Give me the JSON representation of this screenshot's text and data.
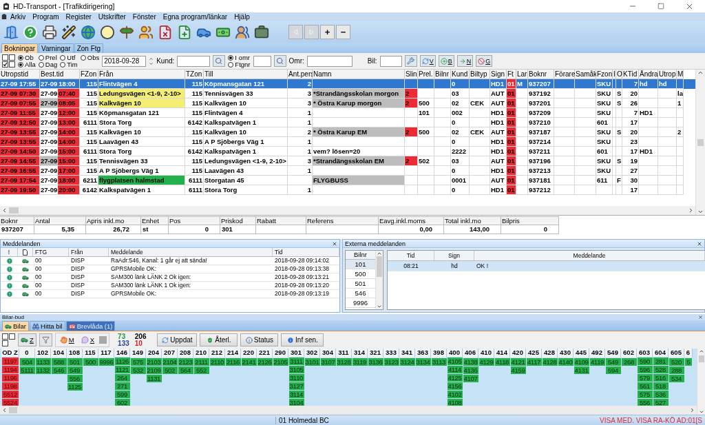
{
  "window": {
    "title": "HD-Transport - [Trafikdirigering]"
  },
  "menu": [
    "Arkiv",
    "Program",
    "Register",
    "Utskrifter",
    "Fönster",
    "Egna program/länkar",
    "Hjälp"
  ],
  "nav_buttons": [
    {
      "kind": "back",
      "disabled": true
    },
    {
      "kind": "forward",
      "disabled": true
    },
    {
      "kind": "text",
      "label": "+",
      "disabled": false
    },
    {
      "kind": "text",
      "label": "−",
      "disabled": false
    }
  ],
  "tabs": [
    {
      "label": "Bokningar",
      "selected": true
    },
    {
      "label": "Varningar",
      "selected": false
    },
    {
      "label": "Zon Ftg",
      "selected": false
    }
  ],
  "filter": {
    "checkboxes": [
      {
        "checked": false
      },
      {
        "checked": false
      },
      {
        "checked": true
      },
      {
        "checked": false
      }
    ],
    "status_radios": [
      {
        "label": "Ob",
        "selected": true
      },
      {
        "label": "Prel",
        "selected": false
      },
      {
        "label": "Utf",
        "selected": false
      },
      {
        "label": "Obs",
        "selected": false
      }
    ],
    "period_radios": [
      {
        "label": "Alla",
        "selected": true
      },
      {
        "label": "Dag",
        "selected": false
      },
      {
        "label": "Tim",
        "selected": false
      }
    ],
    "date": "2018-09-28",
    "kund_label": "Kund:",
    "area_radios": [
      {
        "label": "I omr",
        "selected": true
      },
      {
        "label": "Ftgnr",
        "selected": false
      }
    ],
    "omr_label": "Omr:",
    "bil_label": "Bil:",
    "action_buttons": [
      "V",
      "B",
      "N",
      "G"
    ]
  },
  "bookings": {
    "columns": [
      {
        "label": "Utropstid",
        "kind": "text"
      },
      {
        "label": "Best.tid",
        "kind": "split"
      },
      {
        "label": "FZon",
        "kind": "number"
      },
      {
        "label": "Från",
        "kind": "text"
      },
      {
        "label": "TZon",
        "kind": "number"
      },
      {
        "label": "Till",
        "kind": "text"
      },
      {
        "label": "Ant.pers",
        "kind": "number"
      },
      {
        "label": "Namn",
        "kind": "text"
      },
      {
        "label": "Slin",
        "kind": "text"
      },
      {
        "label": "Prel.",
        "kind": "text"
      },
      {
        "label": "Bilnr",
        "kind": "text"
      },
      {
        "label": "Kund",
        "kind": "text"
      },
      {
        "label": "Biltyp",
        "kind": "text"
      },
      {
        "label": "Sign",
        "kind": "text"
      },
      {
        "label": "Ft",
        "kind": "flag"
      },
      {
        "label": "Lar",
        "kind": "text"
      },
      {
        "label": "Boknr",
        "kind": "text"
      },
      {
        "label": "Förare",
        "kind": "text"
      },
      {
        "label": "Samåk",
        "kind": "text"
      },
      {
        "label": "Fzon",
        "kind": "text"
      },
      {
        "label": "I",
        "kind": "text"
      },
      {
        "label": "O",
        "kind": "text"
      },
      {
        "label": "KTid",
        "kind": "number"
      },
      {
        "label": "Ändra",
        "kind": "text"
      },
      {
        "label": "Utrop",
        "kind": "text"
      },
      {
        "label": "M",
        "kind": "text"
      }
    ],
    "rows": [
      {
        "selected": true,
        "alarm": false,
        "best_gray": false,
        "best_time": "18:00",
        "namn_gray": false,
        "slin_alarm": false,
        "cells": [
          "27-09 17:55",
          "27-09",
          "115",
          "Flintvägen 4",
          "115",
          "Köpmansgatan 121",
          "2",
          null,
          null,
          null,
          null,
          "0",
          null,
          "HD1",
          "01",
          "M",
          "937207",
          null,
          null,
          "SKU",
          null,
          null,
          "7",
          "hd",
          "hd",
          null
        ]
      },
      {
        "selected": false,
        "alarm": true,
        "best_gray": false,
        "best_time": "07:40",
        "color": "#f4ef72",
        "namn_gray": true,
        "slin_alarm": true,
        "cells": [
          "27-09 07:30",
          "27-09",
          "115",
          "Ledungsvägen <1-9, 2-10>",
          "115",
          "Tennisvägen 33",
          "3",
          "*Strandängsskolan morgon",
          "2",
          null,
          null,
          "03",
          null,
          "AUT",
          "01",
          null,
          "937192",
          null,
          null,
          "SKU",
          null,
          "S",
          "20",
          null,
          null,
          "la"
        ]
      },
      {
        "selected": false,
        "alarm": true,
        "best_gray": true,
        "best_time": "08:05",
        "color": "#f4ef72",
        "namn_gray": true,
        "slin_alarm": true,
        "cells": [
          "27-09 07:55",
          "27-09",
          "115",
          "Kalkvägen 10",
          "115",
          "Kalkvägen 10",
          "3",
          "* Östra Karup morgon",
          "2",
          "500",
          null,
          "02",
          "CEK",
          "AUT",
          "01",
          null,
          "937201",
          null,
          null,
          "SKU",
          null,
          "S",
          "26",
          null,
          null,
          "1"
        ]
      },
      {
        "selected": false,
        "alarm": true,
        "best_gray": false,
        "best_time": "12:00",
        "namn_gray": false,
        "slin_alarm": false,
        "cells": [
          "27-09 11:55",
          "27-09",
          "115",
          "Köpmansgatan 121",
          "115",
          "Flintvägen 4",
          "1",
          null,
          null,
          "101",
          null,
          "002",
          null,
          "HD1",
          "01",
          null,
          "937209",
          null,
          null,
          "SKU",
          null,
          null,
          "7",
          "HD1",
          null,
          null
        ]
      },
      {
        "selected": false,
        "alarm": true,
        "best_gray": false,
        "best_time": "13:00",
        "namn_gray": false,
        "slin_alarm": false,
        "cells": [
          "27-09 12:50",
          "27-09",
          "6111",
          "Stora Torg",
          "6142",
          "Kalkspatvägen 1",
          "1",
          null,
          null,
          null,
          null,
          "0",
          null,
          "HD1",
          "01",
          null,
          "937210",
          null,
          null,
          "601",
          null,
          null,
          "17",
          null,
          null,
          null
        ]
      },
      {
        "selected": false,
        "alarm": true,
        "best_gray": false,
        "best_time": "14:00",
        "namn_gray": true,
        "slin_alarm": true,
        "cells": [
          "27-09 13:55",
          "27-09",
          "115",
          "Kalkvägen 10",
          "115",
          "Kalkvägen 10",
          "2",
          "* Östra Karup EM",
          "2",
          "500",
          null,
          "02",
          "CEK",
          "AUT",
          "01",
          null,
          "937187",
          null,
          null,
          "SKU",
          null,
          "S",
          "20",
          null,
          null,
          "2"
        ]
      },
      {
        "selected": false,
        "alarm": true,
        "best_gray": false,
        "best_time": "14:00",
        "namn_gray": false,
        "slin_alarm": false,
        "cells": [
          "27-09 13:55",
          "27-09",
          "115",
          "Laavägen 43",
          "115",
          "A P Sjöbergs Väg 1",
          "1",
          null,
          null,
          null,
          null,
          "0",
          null,
          "HD1",
          "01",
          null,
          "937214",
          null,
          null,
          "SKU",
          null,
          null,
          "23",
          null,
          null,
          null
        ]
      },
      {
        "selected": false,
        "alarm": true,
        "best_gray": false,
        "best_time": "15:00",
        "namn_gray": false,
        "slin_alarm": false,
        "cells": [
          "27-09 14:50",
          "27-09",
          "6111",
          "Stora Torg",
          "6142",
          "Kalkspatvägen 1",
          "1",
          "vem? lösen=20",
          null,
          null,
          null,
          "2222",
          null,
          "HD1",
          "01",
          null,
          "937211",
          null,
          null,
          "601",
          null,
          null,
          "17",
          "HD1",
          null,
          null
        ]
      },
      {
        "selected": false,
        "alarm": true,
        "best_gray": true,
        "best_time": "15:00",
        "namn_gray": true,
        "slin_alarm": true,
        "cells": [
          "27-09 14:55",
          "27-09",
          "115",
          "Tennisvägen 33",
          "115",
          "Ledungsvägen <1-9, 2-10>",
          "3",
          "*Strandängsskolan EM",
          "2",
          "502",
          null,
          "03",
          null,
          "AUT",
          "01",
          null,
          "937196",
          null,
          null,
          "SKU",
          null,
          "S",
          "19",
          null,
          null,
          null
        ]
      },
      {
        "selected": false,
        "alarm": true,
        "best_gray": false,
        "best_time": "17:00",
        "namn_gray": false,
        "slin_alarm": false,
        "cells": [
          "27-09 16:55",
          "27-09",
          "115",
          "A P Sjöbergs Väg 1",
          "115",
          "Laavägen 43",
          "1",
          null,
          null,
          null,
          null,
          "0",
          null,
          "HD1",
          "01",
          null,
          "937213",
          null,
          null,
          "SKU",
          null,
          null,
          "27",
          null,
          null,
          null
        ]
      },
      {
        "selected": false,
        "alarm": true,
        "best_gray": false,
        "best_time": "18:00",
        "color": "#22b14c",
        "namn_gray": true,
        "slin_alarm": false,
        "cells": [
          "27-09 17:54",
          "27-09",
          "6211",
          "flygplatsen halmstad",
          "6111",
          "Storgatan 45",
          null,
          "FLYGBUSS",
          null,
          null,
          null,
          "0001",
          null,
          "AUT",
          "01",
          null,
          "937181",
          null,
          null,
          "611",
          null,
          "F",
          "30",
          null,
          null,
          null
        ]
      },
      {
        "selected": false,
        "alarm": true,
        "best_gray": false,
        "best_time": "20:00",
        "namn_gray": false,
        "slin_alarm": false,
        "cells": [
          "27-09 19:50",
          "27-09",
          "6142",
          "Kalkspatvägen 1",
          "6111",
          "Stora Torg",
          "1",
          null,
          null,
          null,
          null,
          "0",
          null,
          "HD1",
          "01",
          null,
          "937212",
          null,
          null,
          null,
          null,
          null,
          "17",
          null,
          null,
          null
        ]
      }
    ]
  },
  "price": {
    "columns": [
      {
        "label": "Boknr",
        "value": "937207"
      },
      {
        "label": "Antal",
        "value": "5,35"
      },
      {
        "label": "Apris inkl.mo",
        "value": "26,72"
      },
      {
        "label": "Enhet",
        "value": "st"
      },
      {
        "label": "Pos",
        "value": "0"
      },
      {
        "label": "Priskod",
        "value": "301"
      },
      {
        "label": "Rabatt"
      },
      {
        "label": "Referens"
      },
      {
        "label": "Eavg.inkl.moms",
        "value": "0,00"
      },
      {
        "label": "Total inkl.mo",
        "value": "143,00"
      },
      {
        "label": "Bilpris",
        "value": "0"
      }
    ]
  },
  "messages": {
    "title": "Meddelanden",
    "columns": [
      "!",
      "FTG",
      "Från",
      "Meddelande",
      "Tid"
    ],
    "rows": [
      {
        "ftg": "00",
        "from": "DISP",
        "text": "RaAdr:546, Kanal: 1 går ej att sända!",
        "time": "2018-09-28 09:14:02"
      },
      {
        "ftg": "00",
        "from": "DISP",
        "text": "GPRSMobile OK:",
        "time": "2018-09-28 09:13:38"
      },
      {
        "ftg": "00",
        "from": "DISP",
        "text": "SAM300 länk LÄNK 2 Ok igen:",
        "time": "2018-09-28 09:13:21"
      },
      {
        "ftg": "00",
        "from": "DISP",
        "text": "SAM300 länk LÄNK 1 Ok igen:",
        "time": "2018-09-28 09:13:20"
      },
      {
        "ftg": "00",
        "from": "DISP",
        "text": "GPRSMobile OK:",
        "time": "2018-09-28 09:13:19"
      }
    ]
  },
  "external": {
    "title": "Externa meddelanden",
    "car_header": "Bilnr",
    "cars": [
      {
        "label": "101",
        "selected": true
      },
      {
        "label": "500",
        "selected": false
      },
      {
        "label": "501",
        "selected": false
      },
      {
        "label": "546",
        "selected": false
      },
      {
        "label": "9996",
        "selected": false
      }
    ],
    "columns": [
      "Tid",
      "Sign",
      "Meddelande"
    ],
    "rows": [
      {
        "time": "08:21",
        "sign": "hd",
        "text": "OK !",
        "selected": true
      }
    ]
  },
  "fleet": {
    "title": "Bilar-bud",
    "tabs": [
      {
        "label": "Bilar",
        "selected": true,
        "highlighted": false
      },
      {
        "label": "Hitta bil",
        "selected": false,
        "highlighted": false
      },
      {
        "label": "Brevlåda (1)",
        "selected": false,
        "highlighted": true
      }
    ],
    "checkboxes": [
      {
        "checked": false
      },
      {
        "checked": false
      },
      {
        "checked": false
      }
    ],
    "mode_labels": [
      "Z",
      "M",
      "X"
    ],
    "counters": [
      {
        "value": "73",
        "color": "#1f9a3a"
      },
      {
        "value": "206",
        "color": "#000000"
      },
      {
        "value": "133",
        "color": "#2b3f9e"
      },
      {
        "value": "10",
        "color": "#e0202a"
      }
    ],
    "buttons": [
      "Uppdat",
      "Återl.",
      "Status",
      "Inf sen."
    ],
    "od": {
      "label": "OD Z",
      "cars": [
        "1197",
        "1194",
        "1196",
        "1198",
        "5512",
        "5524"
      ]
    },
    "zones": [
      {
        "zone": "0",
        "cars": [
          "504",
          "5111"
        ]
      },
      {
        "zone": "102",
        "cars": [
          "1133",
          "1132"
        ]
      },
      {
        "zone": "104",
        "cars": [
          "588",
          "546"
        ]
      },
      {
        "zone": "108",
        "cars": [
          "501",
          "549",
          "556",
          "1125"
        ]
      },
      {
        "zone": "115",
        "cars": [
          "500"
        ]
      },
      {
        "zone": "117",
        "cars": [
          "9996"
        ]
      },
      {
        "zone": "146",
        "cars": [
          "1126",
          "1121",
          "264",
          "271",
          "599",
          "602"
        ]
      },
      {
        "zone": "149",
        "cars": [
          "575",
          "532"
        ]
      },
      {
        "zone": "204",
        "cars": [
          "2103",
          "2109",
          "1131"
        ]
      },
      {
        "zone": "207",
        "cars": [
          "2104",
          "502"
        ]
      },
      {
        "zone": "208",
        "cars": [
          "2123",
          "564"
        ]
      },
      {
        "zone": "210",
        "cars": [
          "2111",
          "552"
        ]
      },
      {
        "zone": "212",
        "cars": [
          "2110"
        ]
      },
      {
        "zone": "214",
        "cars": [
          "2116"
        ]
      },
      {
        "zone": "220",
        "cars": [
          "2141"
        ]
      },
      {
        "zone": "221",
        "cars": [
          "2126"
        ]
      },
      {
        "zone": "290",
        "cars": [
          "2105"
        ]
      },
      {
        "zone": "301",
        "cars": [
          "3111",
          "3105",
          "3110",
          "3127",
          "3114",
          "3104"
        ]
      },
      {
        "zone": "302",
        "cars": [
          "3101"
        ]
      },
      {
        "zone": "304",
        "cars": [
          "3107"
        ]
      },
      {
        "zone": "311",
        "cars": [
          "3128"
        ]
      },
      {
        "zone": "314",
        "cars": [
          "3119"
        ]
      },
      {
        "zone": "321",
        "cars": [
          "3136"
        ]
      },
      {
        "zone": "333",
        "cars": [
          "3123"
        ]
      },
      {
        "zone": "341",
        "cars": [
          "3124"
        ]
      },
      {
        "zone": "363",
        "cars": [
          "3134"
        ]
      },
      {
        "zone": "398",
        "cars": [
          "3113"
        ]
      },
      {
        "zone": "400",
        "cars": [
          "4105",
          "4114",
          "4125",
          "4156",
          "4102",
          "4108"
        ]
      },
      {
        "zone": "406",
        "cars": [
          "4138",
          "4136",
          "4107"
        ]
      },
      {
        "zone": "410",
        "cars": [
          "4129"
        ]
      },
      {
        "zone": "414",
        "cars": [
          "4118"
        ]
      },
      {
        "zone": "420",
        "cars": [
          "4121",
          "4159"
        ]
      },
      {
        "zone": "425",
        "cars": [
          "4117"
        ]
      },
      {
        "zone": "428",
        "cars": [
          "4128"
        ]
      },
      {
        "zone": "430",
        "cars": [
          "4140"
        ]
      },
      {
        "zone": "445",
        "cars": [
          "4109",
          "4131"
        ]
      },
      {
        "zone": "492",
        "cars": [
          "4119"
        ]
      },
      {
        "zone": "549",
        "cars": [
          "549",
          "594"
        ]
      },
      {
        "zone": "602",
        "cars": [
          "268"
        ]
      },
      {
        "zone": "603",
        "cars": [
          "590",
          "596",
          "579",
          "561",
          "575",
          "556"
        ]
      },
      {
        "zone": "604",
        "cars": [
          "281",
          "528",
          "516",
          "518",
          "536",
          "527"
        ]
      },
      {
        "zone": "605",
        "cars": [
          "520",
          "288",
          "534"
        ]
      },
      {
        "zone": "6",
        "cars": [
          "5"
        ]
      }
    ]
  },
  "status_bar": {
    "office": "01  Holmedal BC",
    "flags": "VISA MED.  VISA RA-KÖ  AD:01[S"
  }
}
